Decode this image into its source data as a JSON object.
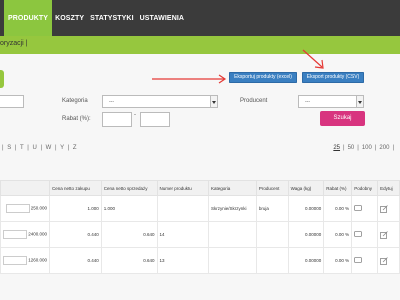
{
  "nav": {
    "items": [
      {
        "label": "PRODUKTY",
        "active": true
      },
      {
        "label": "KOSZTY",
        "active": false
      },
      {
        "label": "STATYSTYKI",
        "active": false
      },
      {
        "label": "USTAWIENIA",
        "active": false
      }
    ]
  },
  "subnav": {
    "label": "oryzacji |"
  },
  "export": {
    "excel_label": "Eksportuj produkty (excel)",
    "csv_label": "Eksport produkty (CSV)"
  },
  "filters": {
    "category_label": "Kategoria",
    "category_value": "---",
    "producer_label": "Producent",
    "producer_value": "---",
    "discount_label": "Rabat (%):",
    "discount_separator": "-",
    "search_label": "Szukaj"
  },
  "letters": "| S | T | U | W | Y | Z",
  "pager": {
    "current": "25",
    "options": [
      "|",
      "50",
      "|",
      "100",
      "|",
      "200",
      "|"
    ]
  },
  "table": {
    "headers": [
      "",
      "Cena netto zakupu",
      "Cena netto sprzedaży",
      "Numer produktu",
      "Kategoria",
      "Producent",
      "Waga (kg)",
      "Rabat (%)",
      "Podobny",
      "Edytuj"
    ],
    "rows": [
      {
        "qty": "250.000",
        "buy": "1.000",
        "sell": "1.000",
        "num": "",
        "cat": "Skrzynie/Skrzynki",
        "prod": "bruja",
        "weight": "0.00000",
        "disc": "0.00 %"
      },
      {
        "qty": "2400.000",
        "buy": "0.440",
        "sell": "0.640",
        "num": "14",
        "cat": "",
        "prod": "",
        "weight": "0.00000",
        "disc": "0.00 %"
      },
      {
        "qty": "1260.000",
        "buy": "0.440",
        "sell": "0.640",
        "num": "13",
        "cat": "",
        "prod": "",
        "weight": "0.00000",
        "disc": "0.00 %"
      }
    ]
  },
  "colors": {
    "nav_bg": "#3b3b3b",
    "accent_green": "#96c73e",
    "export_blue": "#3a7fc1",
    "search_pink": "#d8347f",
    "arrow_red": "#e53935"
  }
}
